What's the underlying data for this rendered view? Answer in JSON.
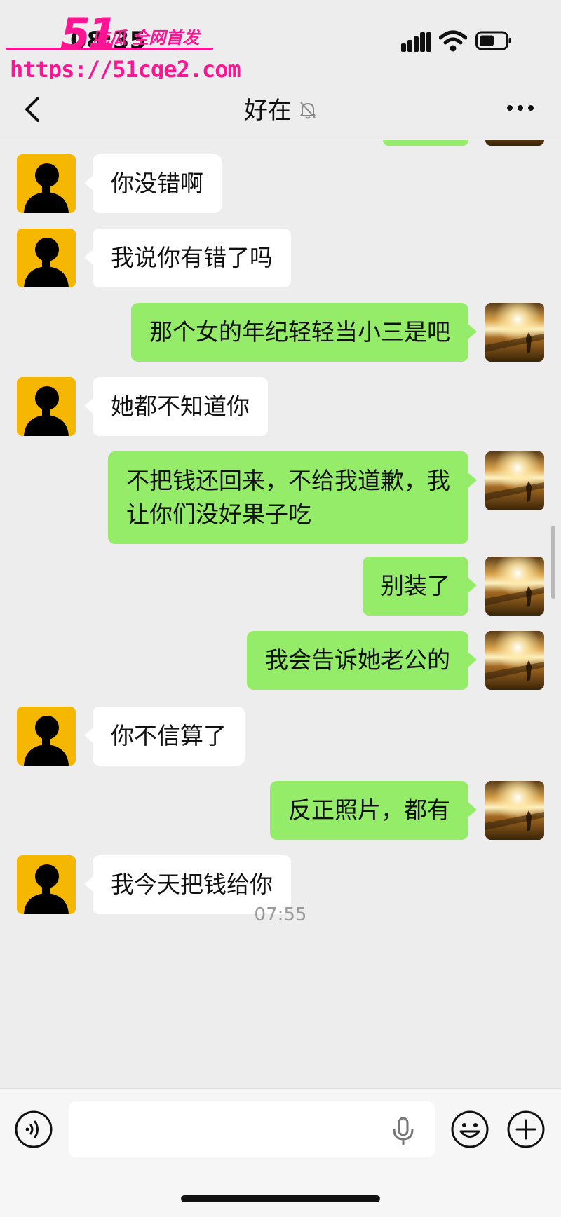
{
  "status_bar": {
    "time": "08:35"
  },
  "watermark": {
    "logo": "51",
    "tagline": "吃瓜 全网首发",
    "url": "https://51cge2.com"
  },
  "nav": {
    "title": "好在",
    "back_icon": "chevron-left-icon",
    "mute_icon": "bell-off-icon",
    "more_icon": "more-dots-icon"
  },
  "messages": [
    {
      "side": "left",
      "text": "你没错啊"
    },
    {
      "side": "left",
      "text": "我说你有错了吗"
    },
    {
      "side": "right",
      "text": "那个女的年纪轻轻当小三是吧"
    },
    {
      "side": "left",
      "text": "她都不知道你"
    },
    {
      "side": "right",
      "text": "不把钱还回来，不给我道歉，我\n让你们没好果子吃"
    },
    {
      "side": "right",
      "text": "别装了"
    },
    {
      "side": "right",
      "text": "我会告诉她老公的"
    },
    {
      "side": "left",
      "text": "你不信算了"
    },
    {
      "side": "right",
      "text": "反正照片，都有"
    },
    {
      "side": "left",
      "text": "我今天把钱给你"
    }
  ],
  "time_divider": "07:55",
  "input_bar": {
    "value": "",
    "voice_icon": "voice-icon",
    "mic_icon": "mic-icon",
    "emoji_icon": "emoji-icon",
    "plus_icon": "plus-icon"
  },
  "colors": {
    "background": "#ededed",
    "bubble_self": "#95ec69",
    "bubble_other": "#ffffff",
    "avatar_other_bg": "#f5b700",
    "watermark": "#ff1493"
  }
}
